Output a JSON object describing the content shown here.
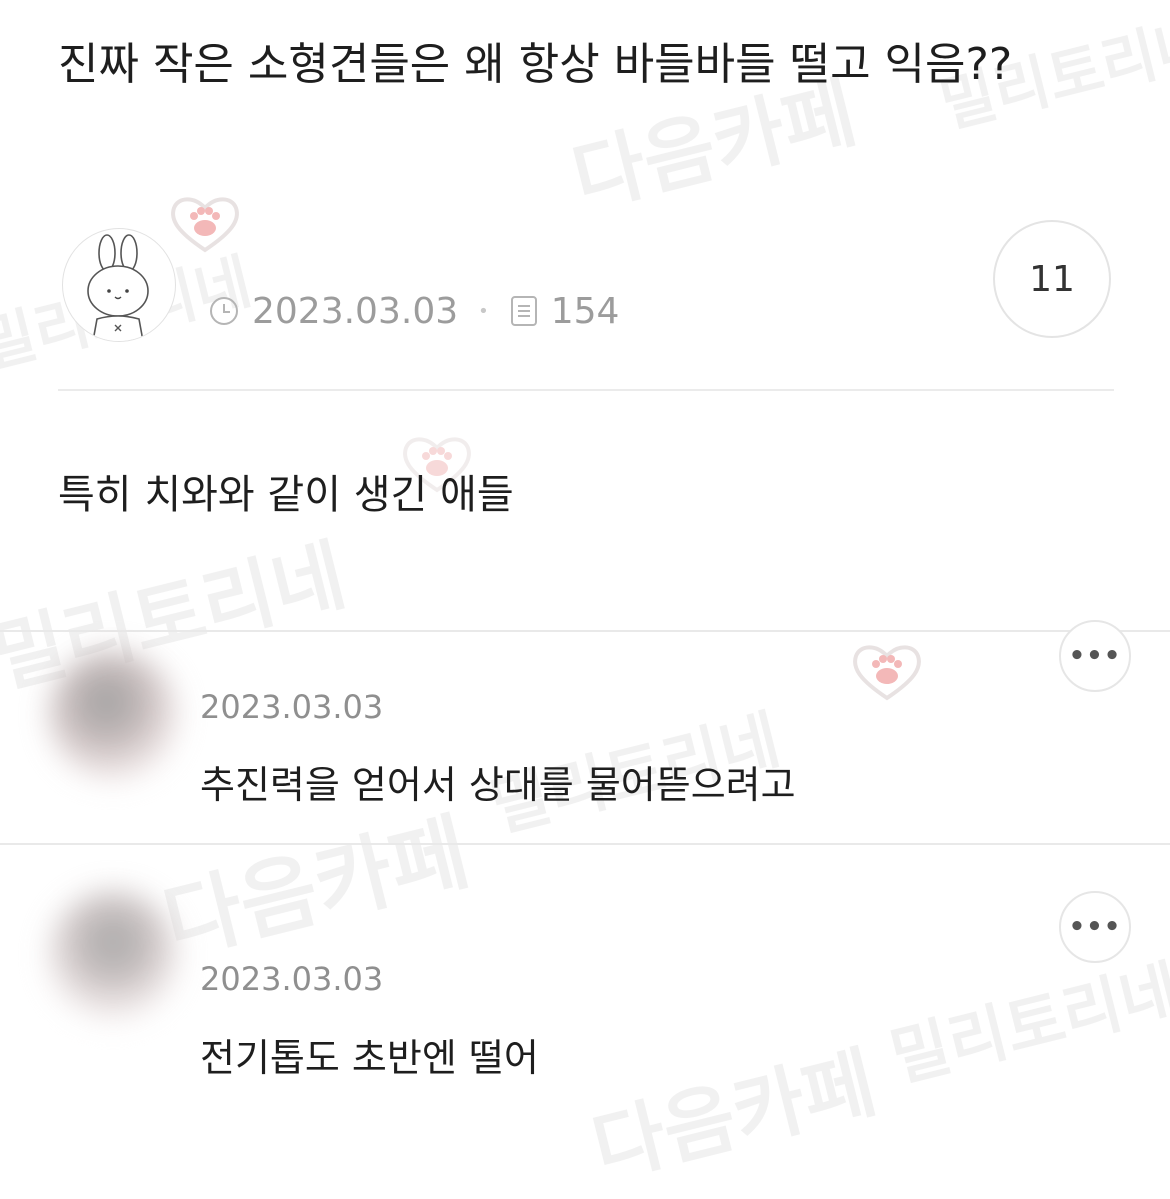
{
  "post": {
    "title": "진짜 작은 소형견들은 왜 항상 바들바들 떨고 익음??",
    "date": "2023.03.03",
    "views": "154",
    "comment_count": "11",
    "body": "특히 치와와 같이 생긴 애들"
  },
  "comments": [
    {
      "date": "2023.03.03",
      "text": "추진력을 얻어서 상대를 물어뜯으려고",
      "more_label": "•••"
    },
    {
      "date": "2023.03.03",
      "text": "전기톱도 초반엔 떨어",
      "more_label": "•••"
    }
  ],
  "watermark": {
    "cafe": "다음카페",
    "source": "밀리토리네"
  },
  "icons": {
    "date": "clock-icon",
    "views": "document-icon",
    "more": "more-dots-icon",
    "avatar": "bunny-avatar-icon",
    "sticker": "paw-heart-icon"
  },
  "colors": {
    "text": "#1e1e1e",
    "meta": "#9c9c9c",
    "divider": "#ebebeb",
    "paw": "#f3b8b8"
  }
}
